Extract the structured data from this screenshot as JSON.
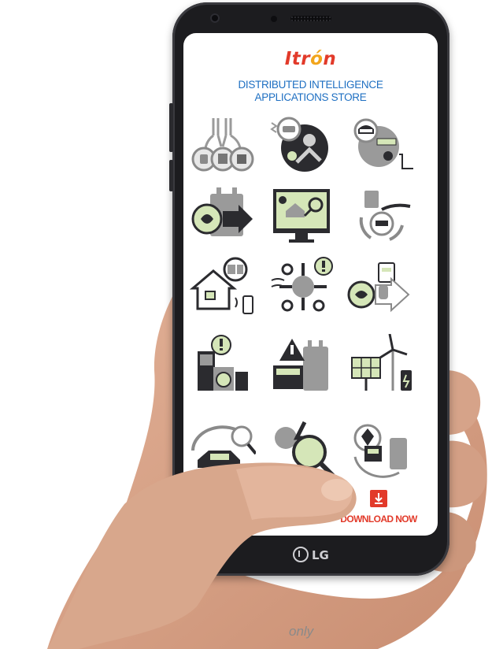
{
  "brand": {
    "name_prefix": "Itr",
    "name_accent": "ó",
    "name_suffix": "n",
    "accent_color": "#e23a2a"
  },
  "title": {
    "line1": "DISTRIBUTED INTELLIGENCE",
    "line2": "APPLICATIONS STORE"
  },
  "apps": [
    {
      "icon": "gas-water-electric-meters-icon"
    },
    {
      "icon": "theft-detection-icon"
    },
    {
      "icon": "meter-theft-icon"
    },
    {
      "icon": "transformer-intelligence-icon"
    },
    {
      "icon": "home-energy-analytics-icon"
    },
    {
      "icon": "meter-transformer-connectivity-icon"
    },
    {
      "icon": "home-devices-icon"
    },
    {
      "icon": "outage-network-icon"
    },
    {
      "icon": "load-disaggregation-icon"
    },
    {
      "icon": "appliance-alerts-icon"
    },
    {
      "icon": "transformer-alert-icon"
    },
    {
      "icon": "solar-wind-battery-icon"
    },
    {
      "icon": "ev-charging-detection-icon"
    },
    {
      "icon": "fault-analysis-icon"
    },
    {
      "icon": "location-awareness-icon"
    }
  ],
  "download": {
    "label": "DOWNLOAD NOW"
  },
  "device": {
    "brand": "LG"
  },
  "caption": {
    "text": "only"
  },
  "colors": {
    "title_blue": "#1e6fc2",
    "icon_gray": "#8a8a8a",
    "icon_green": "#d5e6b8",
    "icon_dark": "#2b2b2f"
  }
}
